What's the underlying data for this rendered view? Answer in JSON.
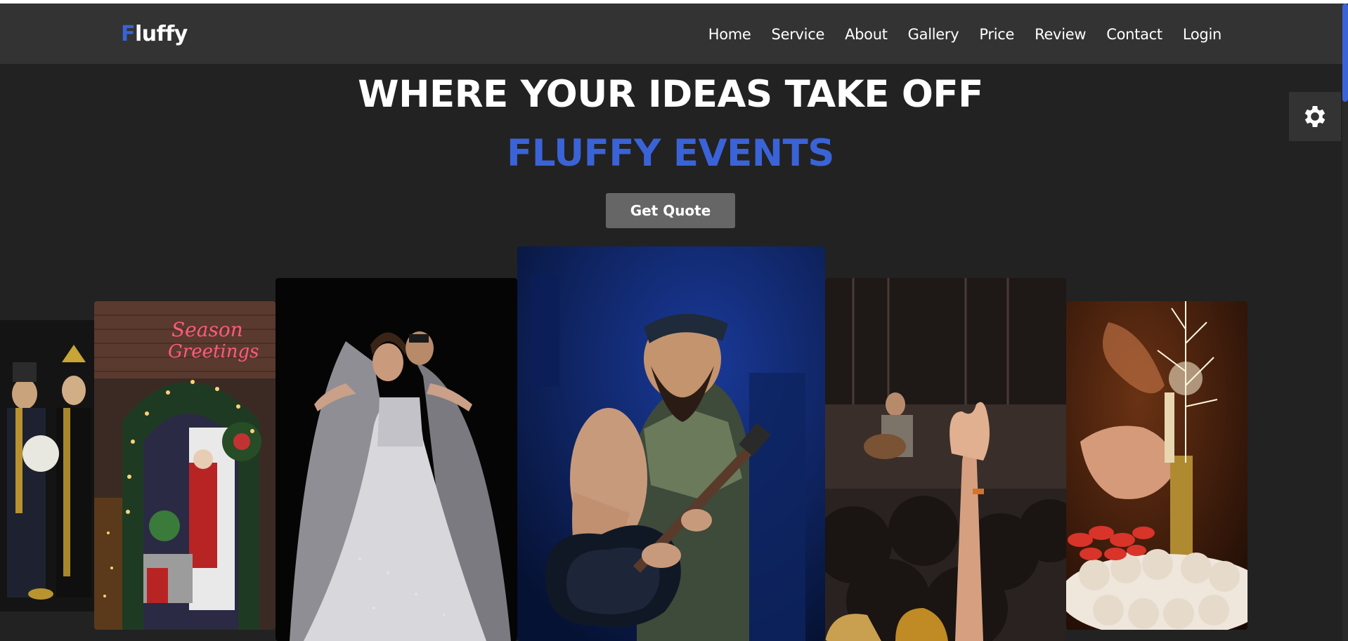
{
  "brand": {
    "first_letter": "F",
    "rest": "luffy"
  },
  "nav": [
    {
      "label": "Home"
    },
    {
      "label": "Service"
    },
    {
      "label": "About"
    },
    {
      "label": "Gallery"
    },
    {
      "label": "Price"
    },
    {
      "label": "Review"
    },
    {
      "label": "Contact"
    },
    {
      "label": "Login"
    }
  ],
  "hero": {
    "title": "WHERE YOUR IDEAS TAKE OFF",
    "subtitle": "FLUFFY EVENTS",
    "cta_label": "Get Quote"
  },
  "colors": {
    "accent": "#3a63d8",
    "bg": "#222222",
    "nav_bg": "#333333",
    "button": "#666666"
  },
  "icons": {
    "settings": "gear-icon"
  },
  "gallery": {
    "images": [
      {
        "subject": "traditional wedding couple"
      },
      {
        "subject": "christmas decorated doorway",
        "caption": "Season's Greetings"
      },
      {
        "subject": "bride in white gown"
      },
      {
        "subject": "bearded guitarist performing"
      },
      {
        "subject": "concert crowd with raised hand"
      },
      {
        "subject": "cake with sparkler candle"
      }
    ]
  }
}
